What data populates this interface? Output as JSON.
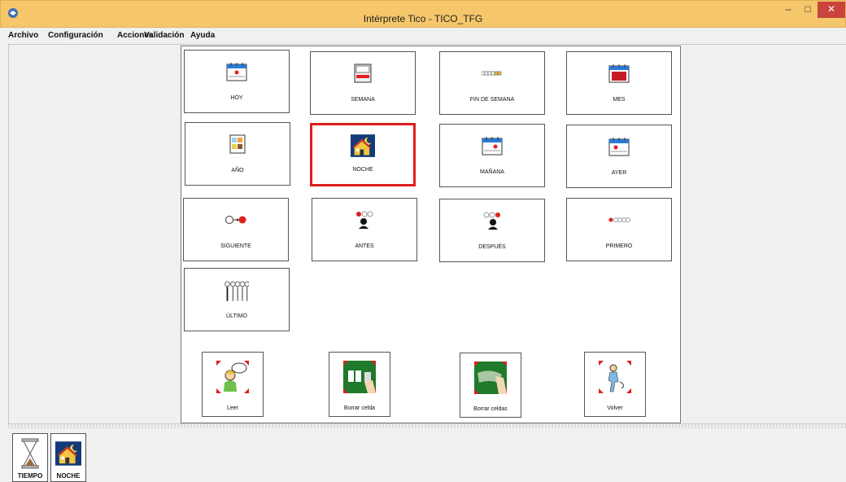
{
  "window": {
    "title": "Intérprete Tico - TICO_TFG"
  },
  "menu": [
    {
      "label": "Archivo"
    },
    {
      "label": "Configuración"
    },
    {
      "label": "Acciones"
    },
    {
      "label": "Validación"
    },
    {
      "label": "Ayuda"
    }
  ],
  "cells": [
    {
      "label": "HOY",
      "icon": "calendar-today-icon"
    },
    {
      "label": "SEMANA",
      "icon": "calendar-week-icon"
    },
    {
      "label": "FIN DE SEMANA",
      "icon": "weekend-icon"
    },
    {
      "label": "MES",
      "icon": "calendar-month-icon"
    },
    {
      "label": "AÑO",
      "icon": "calendar-year-icon"
    },
    {
      "label": "NOCHE",
      "icon": "night-house-icon"
    },
    {
      "label": "MAÑANA",
      "icon": "calendar-tomorrow-icon"
    },
    {
      "label": "AYER",
      "icon": "calendar-yesterday-icon"
    },
    {
      "label": "SIGUIENTE",
      "icon": "next-icon"
    },
    {
      "label": "ANTES",
      "icon": "before-icon"
    },
    {
      "label": "DESPUÉS",
      "icon": "after-icon"
    },
    {
      "label": "PRIMERO",
      "icon": "first-icon"
    },
    {
      "label": "ÚLTIMO",
      "icon": "last-icon"
    }
  ],
  "controls": [
    {
      "label": "Leer",
      "icon": "read-aloud-icon"
    },
    {
      "label": "Borrar celda",
      "icon": "delete-cell-icon"
    },
    {
      "label": "Borrar celdas",
      "icon": "delete-cells-icon"
    },
    {
      "label": "Volver",
      "icon": "go-back-icon"
    }
  ],
  "message_bar": [
    {
      "label": "TIEMPO",
      "icon": "hourglass-icon"
    },
    {
      "label": "NOCHE",
      "icon": "night-house-icon"
    }
  ],
  "colors": {
    "titlebar": "#f5c66a",
    "selected": "#e01e1e",
    "close": "#c9443c"
  }
}
